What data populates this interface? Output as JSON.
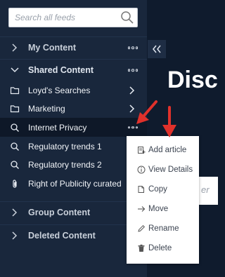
{
  "search": {
    "placeholder": "Search all feeds",
    "value": ""
  },
  "sidebar": {
    "sections": [
      {
        "label": "My Content",
        "expanded": false
      },
      {
        "label": "Shared Content",
        "expanded": true
      },
      {
        "label": "Group Content",
        "expanded": false
      },
      {
        "label": "Deleted Content",
        "expanded": false
      }
    ],
    "shared_items": [
      {
        "label": "Loyd's Searches",
        "icon": "folder-icon"
      },
      {
        "label": "Marketing",
        "icon": "folder-icon"
      },
      {
        "label": "Internet Privacy",
        "icon": "search-icon",
        "active": true
      },
      {
        "label": "Regulatory trends 1",
        "icon": "search-icon"
      },
      {
        "label": "Regulatory trends 2",
        "icon": "search-icon"
      },
      {
        "label": "Right of Publicity curated",
        "icon": "paperclip-icon"
      }
    ]
  },
  "main": {
    "heading_fragment": "Disc",
    "input_fragment": "er"
  },
  "context_menu": {
    "items": [
      {
        "label": "Add article",
        "icon": "add-article-icon"
      },
      {
        "label": "View Details",
        "icon": "info-icon"
      },
      {
        "label": "Copy",
        "icon": "copy-icon"
      },
      {
        "label": "Move",
        "icon": "arrow-right-icon"
      },
      {
        "label": "Rename",
        "icon": "pencil-icon"
      },
      {
        "label": "Delete",
        "icon": "trash-icon"
      }
    ]
  },
  "colors": {
    "sidebar_bg": "#19273c",
    "page_bg": "#0f1b2d",
    "annotation_arrow": "#e0312b"
  }
}
